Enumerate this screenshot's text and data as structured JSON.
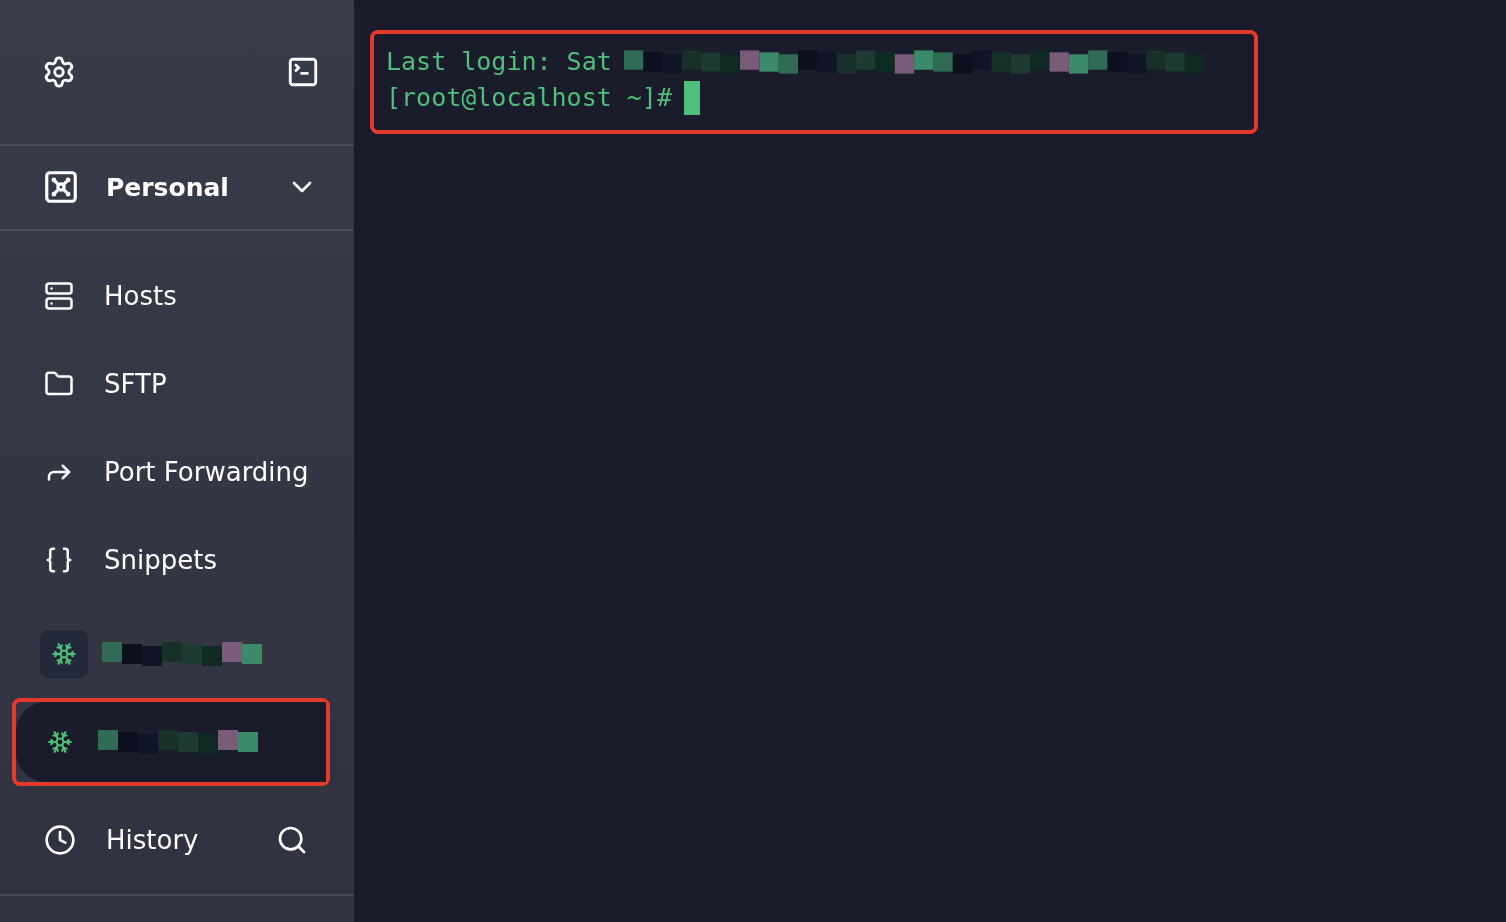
{
  "sidebar": {
    "vault": {
      "label": "Personal"
    },
    "nav": [
      {
        "label": "Hosts",
        "selected": false
      },
      {
        "label": "SFTP",
        "selected": false
      },
      {
        "label": "Port Forwarding",
        "selected": false
      },
      {
        "label": "Snippets",
        "selected": false
      }
    ],
    "sessions": [
      {
        "selected": false,
        "highlighted": false
      },
      {
        "selected": true,
        "highlighted": true
      }
    ],
    "history": {
      "label": "History"
    }
  },
  "terminal": {
    "highlighted": true,
    "cursor": true,
    "lines": [
      {
        "text": "Last login: Sat",
        "redacted": true
      },
      {
        "text": "[root@localhost ~]#",
        "redacted": false
      }
    ]
  }
}
